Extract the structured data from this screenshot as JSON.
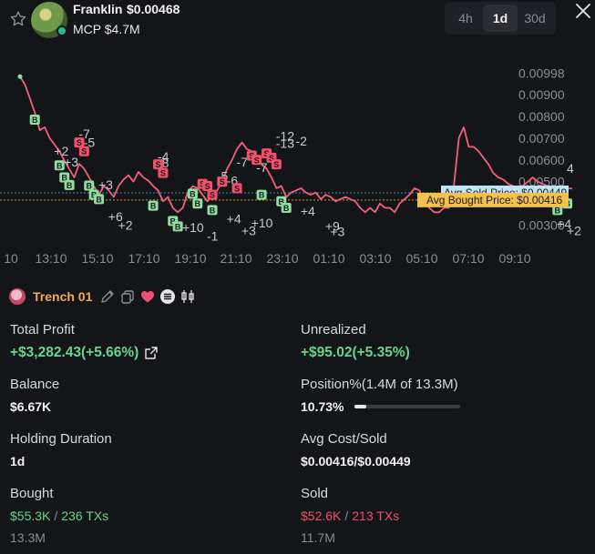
{
  "header": {
    "token_name": "Franklin",
    "token_price": "$0.00468",
    "mcp": "MCP $4.7M",
    "timeframes": [
      {
        "label": "4h",
        "active": false
      },
      {
        "label": "1d",
        "active": true
      },
      {
        "label": "30d",
        "active": false
      }
    ]
  },
  "chart_data": {
    "type": "line",
    "y_ticks": [
      "0.00998",
      "0.00900",
      "0.00800",
      "0.00700",
      "0.00600",
      "0.00500",
      "0.00300"
    ],
    "x_ticks": [
      "10",
      "13:10",
      "15:10",
      "17:10",
      "19:10",
      "21:10",
      "23:10",
      "01:10",
      "03:10",
      "05:10",
      "07:10",
      "09:10"
    ],
    "ylim": [
      0.0019,
      0.0105
    ],
    "line_color": "#f0607a",
    "series": [
      {
        "values": [
          0.00982,
          0.00946,
          0.00882,
          0.00818,
          0.00736,
          0.0075,
          0.007,
          0.0067,
          0.0064,
          0.00596,
          0.00558,
          0.0052,
          0.00582,
          0.0056,
          0.0052,
          0.00478,
          0.0044,
          0.0048,
          0.0046,
          0.0043,
          0.0048,
          0.0051,
          0.0053,
          0.005,
          0.00545,
          0.0052,
          0.00505,
          0.0048,
          0.0046,
          0.0041,
          0.0043,
          0.0038,
          0.0036,
          0.0038,
          0.0045,
          0.0048,
          0.0047,
          0.0044,
          0.0041,
          0.0044,
          0.0046,
          0.005,
          0.0056,
          0.006,
          0.0065,
          0.0068,
          0.0065,
          0.0064,
          0.0062,
          0.0058,
          0.0056,
          0.0052,
          0.0047,
          0.0048,
          0.0043,
          0.0045,
          0.0046,
          0.0047,
          0.0045,
          0.0044,
          0.0045,
          0.0042,
          0.0044,
          0.0043,
          0.0041,
          0.0042,
          0.0043,
          0.0042,
          0.0041,
          0.0038,
          0.0036,
          0.0038,
          0.0036,
          0.004,
          0.0038,
          0.0038,
          0.0036,
          0.004,
          0.0042,
          0.0044,
          0.0047,
          0.0046,
          0.0041,
          0.0038,
          0.0036,
          0.0036,
          0.0038,
          0.0038,
          0.0048,
          0.007,
          0.0075,
          0.0066,
          0.0066,
          0.0064,
          0.0061,
          0.0058,
          0.0054,
          0.0052,
          0.0051,
          0.0049,
          0.0048,
          0.0046,
          0.0048,
          0.005,
          0.0052,
          0.005,
          0.0049,
          0.0048,
          0.0047,
          0.0046,
          0.0048,
          0.0047,
          0.00468
        ]
      }
    ],
    "avg_sold": {
      "label": "Avg Sold Price: $0.00449",
      "value": 0.00449,
      "color": "#bfe4f7"
    },
    "avg_bought": {
      "label": "Avg Bought Price: $0.00416",
      "value": 0.00416,
      "color": "#f4c04e"
    },
    "buy_markers": [
      {
        "index": 3,
        "value": 0.00785
      },
      {
        "index": 8,
        "value": 0.00575
      },
      {
        "index": 9,
        "value": 0.0052
      },
      {
        "index": 10,
        "value": 0.00485
      },
      {
        "index": 14,
        "value": 0.00482
      },
      {
        "index": 15,
        "value": 0.0044
      },
      {
        "index": 16,
        "value": 0.0042
      },
      {
        "index": 27,
        "value": 0.0039
      },
      {
        "index": 31,
        "value": 0.0032
      },
      {
        "index": 32,
        "value": 0.00295
      },
      {
        "index": 35,
        "value": 0.00445
      },
      {
        "index": 36,
        "value": 0.004
      },
      {
        "index": 39,
        "value": 0.0037
      },
      {
        "index": 49,
        "value": 0.0044
      },
      {
        "index": 53,
        "value": 0.0041
      },
      {
        "index": 54,
        "value": 0.0038
      },
      {
        "index": 107,
        "value": 0.0043
      },
      {
        "index": 109,
        "value": 0.0037
      },
      {
        "index": 111,
        "value": 0.004
      }
    ],
    "sell_markers": [
      {
        "index": 12,
        "value": 0.0068
      },
      {
        "index": 13,
        "value": 0.0064
      },
      {
        "index": 28,
        "value": 0.0058
      },
      {
        "index": 29,
        "value": 0.0054
      },
      {
        "index": 37,
        "value": 0.0049
      },
      {
        "index": 38,
        "value": 0.0048
      },
      {
        "index": 39,
        "value": 0.0044
      },
      {
        "index": 41,
        "value": 0.005
      },
      {
        "index": 44,
        "value": 0.0047
      },
      {
        "index": 47,
        "value": 0.0062
      },
      {
        "index": 48,
        "value": 0.006
      },
      {
        "index": 50,
        "value": 0.0063
      },
      {
        "index": 51,
        "value": 0.0061
      },
      {
        "index": 52,
        "value": 0.0058
      }
    ],
    "annotations": [
      {
        "text": "-7",
        "index": 13,
        "value": 0.007
      },
      {
        "text": "-5",
        "index": 14,
        "value": 0.0066
      },
      {
        "text": "+2",
        "index": 8,
        "value": 0.0062
      },
      {
        "text": "+3",
        "index": 10,
        "value": 0.0057
      },
      {
        "text": "-4",
        "index": 29,
        "value": 0.00595
      },
      {
        "text": "-8",
        "index": 29,
        "value": 0.00565
      },
      {
        "text": "+3",
        "index": 17,
        "value": 0.00465
      },
      {
        "text": "+6",
        "index": 19,
        "value": 0.0032
      },
      {
        "text": "+2",
        "index": 21,
        "value": 0.0028
      },
      {
        "text": "-5",
        "index": 41,
        "value": 0.00505
      },
      {
        "text": "-6",
        "index": 43,
        "value": 0.00485
      },
      {
        "text": "-7",
        "index": 45,
        "value": 0.0057
      },
      {
        "text": "-7",
        "index": 49,
        "value": 0.00545
      },
      {
        "text": "+10",
        "index": 34,
        "value": 0.0027
      },
      {
        "text": "+4",
        "index": 43,
        "value": 0.0031
      },
      {
        "text": "+10",
        "index": 48,
        "value": 0.0029
      },
      {
        "text": "+3",
        "index": 46,
        "value": 0.00255
      },
      {
        "text": "-1",
        "index": 39,
        "value": 0.0023
      },
      {
        "text": "-12",
        "index": 53,
        "value": 0.00688
      },
      {
        "text": "-13",
        "index": 53,
        "value": 0.00655
      },
      {
        "text": "-2",
        "index": 57,
        "value": 0.00665
      },
      {
        "text": "+4",
        "index": 58,
        "value": 0.00345
      },
      {
        "text": "+9",
        "index": 63,
        "value": 0.00275
      },
      {
        "text": "+3",
        "index": 64,
        "value": 0.0025
      },
      {
        "text": "4",
        "index": 112,
        "value": 0.0054
      },
      {
        "text": "+4",
        "index": 110,
        "value": 0.00285
      },
      {
        "text": "+2",
        "index": 112,
        "value": 0.00255
      }
    ]
  },
  "trench": {
    "name": "Trench 01"
  },
  "stats": {
    "total_profit_label": "Total Profit",
    "total_profit_value": "+$3,282.43(+5.66%)",
    "unrealized_label": "Unrealized",
    "unrealized_value": "+$95.02(+5.35%)",
    "balance_label": "Balance",
    "balance_value": "$6.67K",
    "position_label": "Position%(1.4M of 13.3M)",
    "position_value": "10.73%",
    "position_fraction": 0.1073,
    "holding_label": "Holding Duration",
    "holding_value": "1d",
    "avg_cost_label": "Avg Cost/Sold",
    "avg_cost_value": "$0.00416/$0.00449",
    "bought_label": "Bought",
    "bought_amount": "$55.3K",
    "bought_slash": "/",
    "bought_txs": "236 TXs",
    "bought_tokens": "13.3M",
    "sold_label": "Sold",
    "sold_amount": "$52.6K",
    "sold_slash": "/",
    "sold_txs": "213 TXs",
    "sold_tokens": "11.7M"
  },
  "colors": {
    "green": "#65d68a",
    "red": "#f0506a",
    "orange": "#f0a95a",
    "marker_buy": "#8ee0a0",
    "marker_sell": "#f0506a"
  }
}
